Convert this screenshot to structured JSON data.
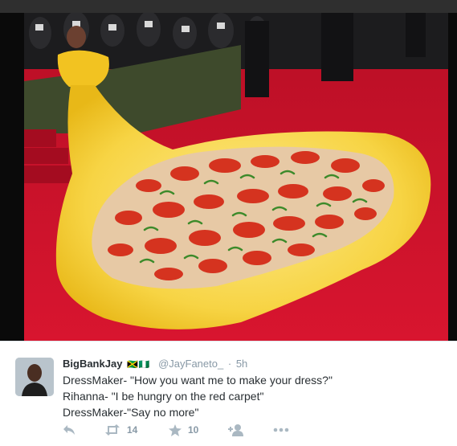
{
  "tweet": {
    "name": "BigBankJay",
    "name_flags": "🇯🇲🇳🇬",
    "handle": "@JayFaneto_",
    "separator": "·",
    "time": "5h",
    "lines": [
      "DressMaker- \"How you want me to make your dress?\"",
      "Rihanna- \"I be hungry on the red carpet\"",
      "DressMaker-\"Say no more\""
    ],
    "retweet_count": "14",
    "favorite_count": "10"
  },
  "icons": {
    "reply": "reply-icon",
    "retweet": "retweet-icon",
    "favorite": "star-icon",
    "follow": "add-user-icon",
    "more": "more-dots-icon"
  },
  "colors": {
    "action_gray": "#aab8c2",
    "name": "#292f33",
    "meta": "#8899a6",
    "carpet_red": "#c8102e",
    "dress_yellow": "#f4d33c"
  }
}
